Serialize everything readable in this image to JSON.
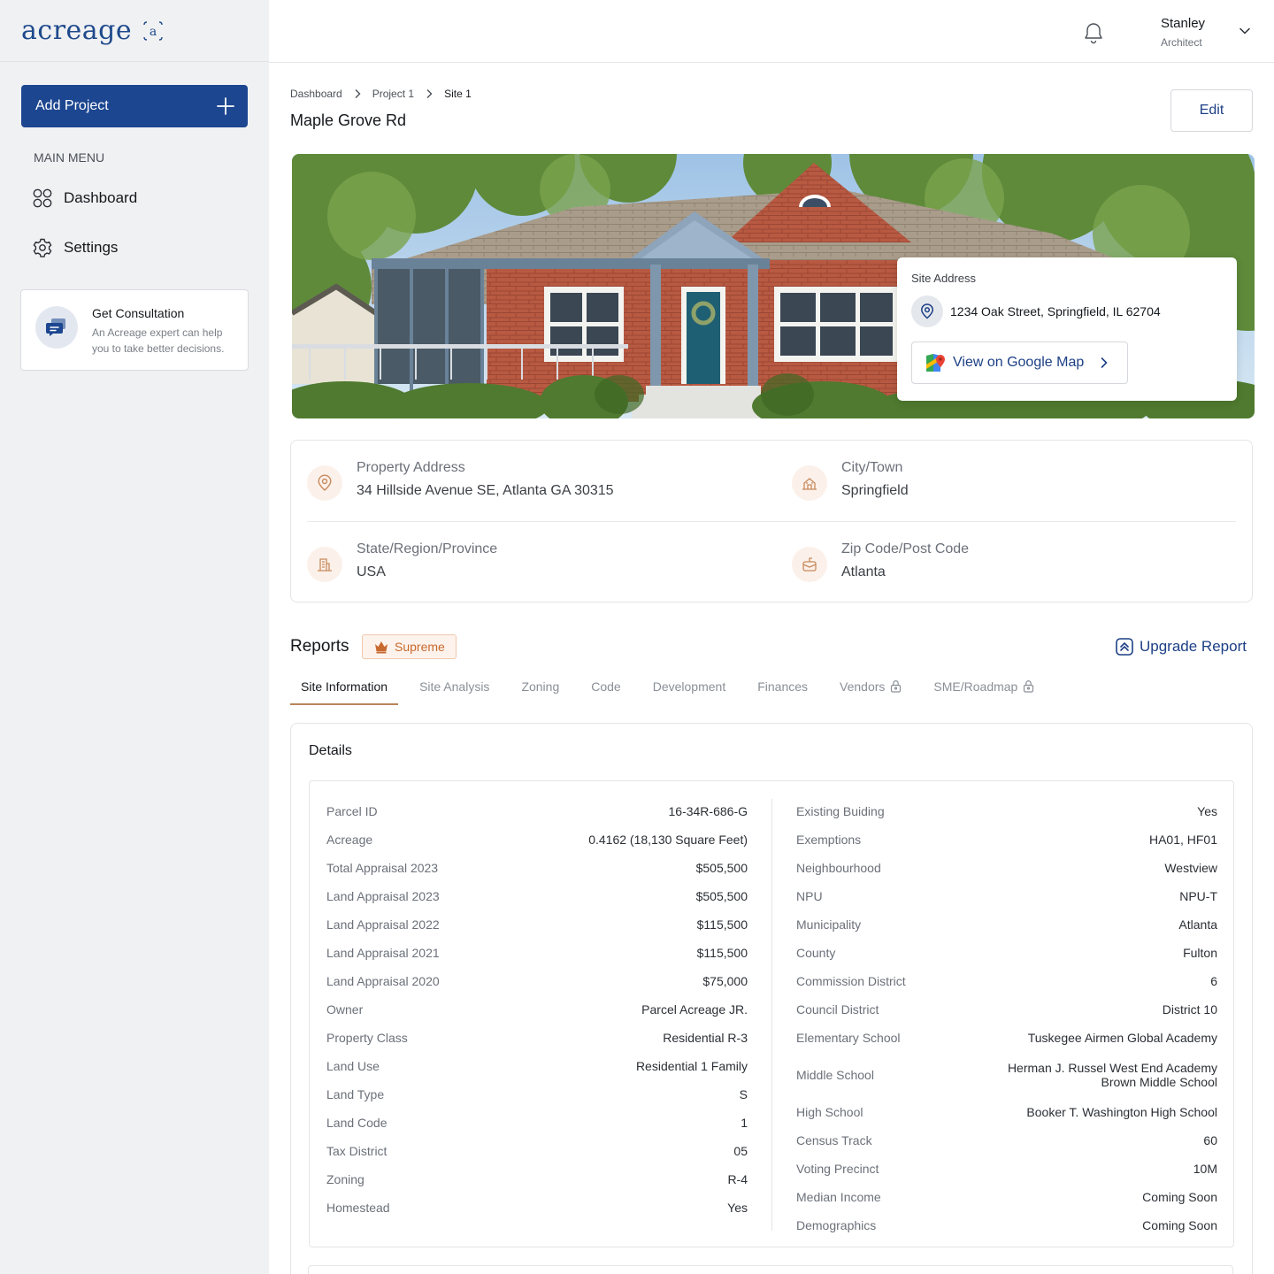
{
  "brand": {
    "logo_text": "acreage",
    "logo_mark": "a"
  },
  "sidebar": {
    "add_project_label": "Add Project",
    "menu_label": "MAIN MENU",
    "items": [
      {
        "label": "Dashboard",
        "icon": "grid-icon"
      },
      {
        "label": "Settings",
        "icon": "gear-icon"
      }
    ],
    "consultation": {
      "title": "Get Consultation",
      "desc_line1": "An Acreage expert can help",
      "desc_line2": "you to take better decisions."
    }
  },
  "header": {
    "user_name": "Stanley",
    "user_role": "Architect"
  },
  "breadcrumb": [
    "Dashboard",
    "Project 1",
    "Site 1"
  ],
  "page": {
    "title": "Maple Grove Rd",
    "edit_label": "Edit"
  },
  "site_card": {
    "label": "Site Address",
    "address": "1234 Oak Street, Springfield, IL 62704",
    "map_button": "View on Google Map"
  },
  "property": [
    {
      "label": "Property Address",
      "value": "34 Hillside Avenue SE, Atlanta GA 30315"
    },
    {
      "label": "City/Town",
      "value": "Springfield"
    },
    {
      "label": "State/Region/Province",
      "value": "USA"
    },
    {
      "label": "Zip Code/Post Code",
      "value": "Atlanta"
    }
  ],
  "reports": {
    "title": "Reports",
    "badge": "Supreme",
    "upgrade_label": "Upgrade Report",
    "tabs": [
      {
        "label": "Site Information",
        "active": true,
        "locked": false
      },
      {
        "label": "Site Analysis",
        "active": false,
        "locked": false
      },
      {
        "label": "Zoning",
        "active": false,
        "locked": false
      },
      {
        "label": "Code",
        "active": false,
        "locked": false
      },
      {
        "label": "Development",
        "active": false,
        "locked": false
      },
      {
        "label": "Finances",
        "active": false,
        "locked": false
      },
      {
        "label": "Vendors",
        "active": false,
        "locked": true
      },
      {
        "label": "SME/Roadmap",
        "active": false,
        "locked": true
      }
    ]
  },
  "details": {
    "title": "Details",
    "left": [
      {
        "k": "Parcel ID",
        "v": "16-34R-686-G"
      },
      {
        "k": "Acreage",
        "v": "0.4162 (18,130 Square Feet)"
      },
      {
        "k": "Total Appraisal 2023",
        "v": "$505,500"
      },
      {
        "k": "Land Appraisal 2023",
        "v": "$505,500"
      },
      {
        "k": "Land Appraisal 2022",
        "v": "$115,500"
      },
      {
        "k": "Land Appraisal 2021",
        "v": "$115,500"
      },
      {
        "k": "Land Appraisal 2020",
        "v": "$75,000"
      },
      {
        "k": "Owner",
        "v": "Parcel Acreage JR."
      },
      {
        "k": "Property Class",
        "v": "Residential R-3"
      },
      {
        "k": "Land Use",
        "v": "Residential 1 Family"
      },
      {
        "k": "Land Type",
        "v": "S"
      },
      {
        "k": "Land Code",
        "v": "1"
      },
      {
        "k": "Tax District",
        "v": "05"
      },
      {
        "k": "Zoning",
        "v": "R-4"
      },
      {
        "k": "Homestead",
        "v": "Yes"
      }
    ],
    "right": [
      {
        "k": "Existing Buiding",
        "v": "Yes"
      },
      {
        "k": "Exemptions",
        "v": "HA01, HF01"
      },
      {
        "k": "Neighbourhood",
        "v": "Westview"
      },
      {
        "k": "NPU",
        "v": "NPU-T"
      },
      {
        "k": "Municipality",
        "v": "Atlanta"
      },
      {
        "k": "County",
        "v": "Fulton"
      },
      {
        "k": "Commission District",
        "v": "6"
      },
      {
        "k": "Council District",
        "v": "District 10"
      },
      {
        "k": "Elementary School",
        "v": "Tuskegee Airmen Global Academy"
      },
      {
        "k": "Middle School",
        "v": "Herman J. Russel West End Academy",
        "v2": "Brown Middle School"
      },
      {
        "k": "High School",
        "v": "Booker T. Washington High School"
      },
      {
        "k": "Census Track",
        "v": "60"
      },
      {
        "k": "Voting Precinct",
        "v": "10M"
      },
      {
        "k": "Median Income",
        "v": "Coming Soon"
      },
      {
        "k": "Demographics",
        "v": "Coming Soon"
      }
    ]
  },
  "colors": {
    "primary": "#1c4690",
    "accent": "#c8692f",
    "sidebar_bg": "#f0f1f3"
  }
}
